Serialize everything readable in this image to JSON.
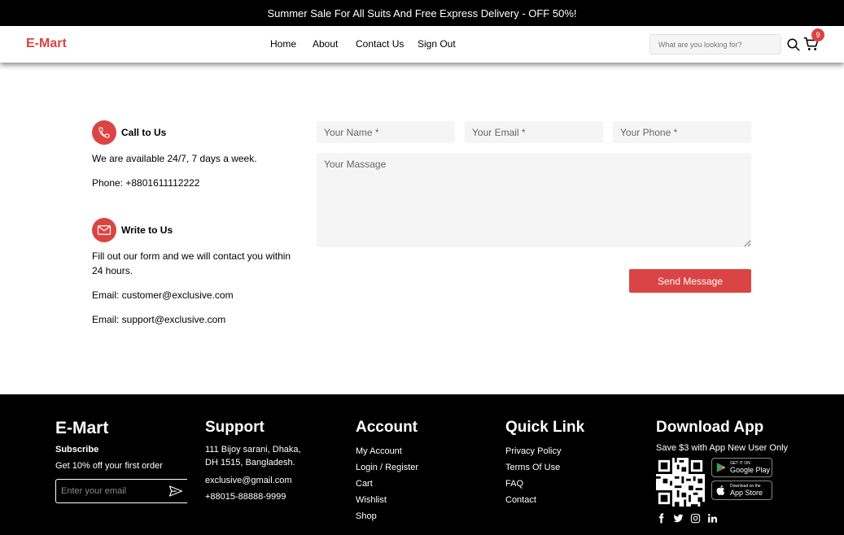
{
  "banner": {
    "text": "Summer Sale For All Suits And Free Express Delivery - OFF 50%!"
  },
  "header": {
    "logo": "E-Mart",
    "nav": [
      "Home",
      "About",
      "Contact Us",
      "Sign Out"
    ],
    "search_placeholder": "What are you looking for?",
    "cart_count": "9",
    "accent": "#db4444"
  },
  "contact": {
    "call": {
      "title": "Call to Us",
      "line1": "We are available 24/7, 7 days a week.",
      "line2": "Phone: +8801611112222"
    },
    "write": {
      "title": "Write to Us",
      "line1": "Fill out our form and we will contact you within 24 hours.",
      "line2": "Email: customer@exclusive.com",
      "line3": "Email: support@exclusive.com"
    },
    "form": {
      "name_placeholder": "Your Name *",
      "email_placeholder": "Your Email *",
      "phone_placeholder": "Your Phone *",
      "message_placeholder": "Your Massage",
      "send_label": "Send Message"
    }
  },
  "footer": {
    "brand": {
      "title": "E-Mart",
      "subscribe": "Subscribe",
      "offer": "Get 10% off your first order",
      "email_placeholder": "Enter your email"
    },
    "support": {
      "title": "Support",
      "address": "111 Bijoy sarani, Dhaka, DH 1515, Bangladesh.",
      "email": "exclusive@gmail.com",
      "phone": "+88015-88888-9999"
    },
    "account": {
      "title": "Account",
      "links": [
        "My Account",
        "Login / Register",
        "Cart",
        "Wishlist",
        "Shop"
      ]
    },
    "quick": {
      "title": "Quick Link",
      "links": [
        "Privacy Policy",
        "Terms Of Use",
        "FAQ",
        "Contact"
      ]
    },
    "app": {
      "title": "Download App",
      "save": "Save $3 with App New User Only",
      "google_small": "GET IT ON",
      "google_big": "Google Play",
      "apple_small": "Download on the",
      "apple_big": "App Store"
    }
  }
}
